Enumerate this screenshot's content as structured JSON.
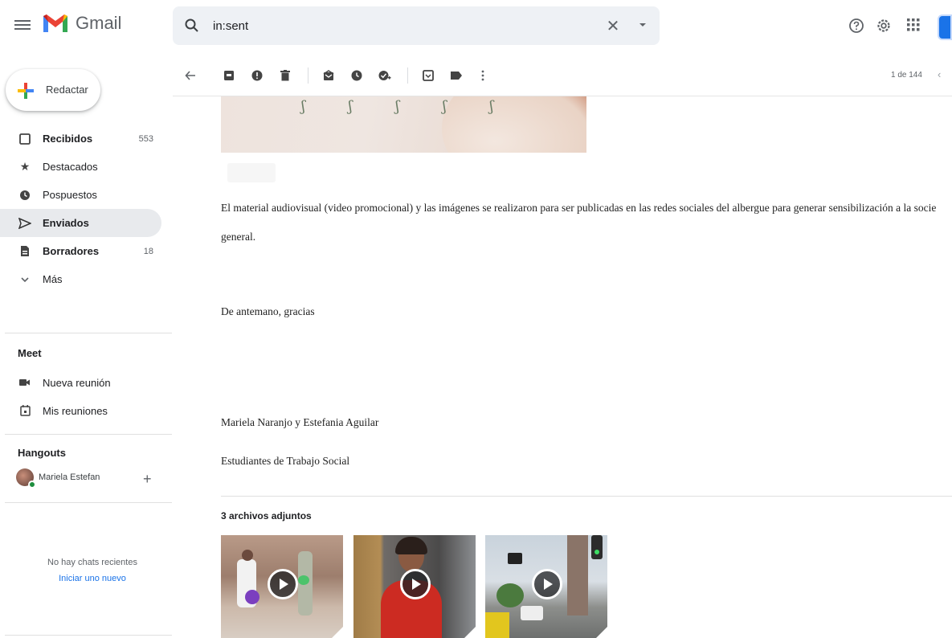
{
  "header": {
    "app_name": "Gmail",
    "search": {
      "value": "in:sent",
      "clear_label": "✕"
    }
  },
  "sidebar": {
    "compose_label": "Redactar",
    "items": [
      {
        "label": "Recibidos",
        "count": "553",
        "icon": "inbox-icon",
        "bold": true,
        "active": false
      },
      {
        "label": "Destacados",
        "count": "",
        "icon": "star-icon",
        "bold": false,
        "active": false
      },
      {
        "label": "Pospuestos",
        "count": "",
        "icon": "clock-icon",
        "bold": false,
        "active": false
      },
      {
        "label": "Enviados",
        "count": "",
        "icon": "send-icon",
        "bold": true,
        "active": true
      },
      {
        "label": "Borradores",
        "count": "18",
        "icon": "draft-icon",
        "bold": true,
        "active": false
      },
      {
        "label": "Más",
        "count": "",
        "icon": "chevron-down-icon",
        "bold": false,
        "active": false
      }
    ],
    "meet": {
      "title": "Meet",
      "new_meeting": "Nueva reunión",
      "my_meetings": "Mis reuniones"
    },
    "hangouts": {
      "title": "Hangouts",
      "user_name": "Mariela Estefan",
      "no_chats": "No hay chats recientes",
      "start_new": "Iniciar uno nuevo"
    }
  },
  "toolbar": {
    "pager": "1 de 144",
    "prev_glyph": "‹"
  },
  "message": {
    "paragraph_line1": "El material audiovisual (video promocional) y las imágenes se realizaron para ser publicadas en las redes sociales del albergue para generar sensibilización a la socie",
    "paragraph_line2": "general.",
    "thanks": "De antemano, gracias",
    "signature_names": "Mariela Naranjo y Estefania Aguilar",
    "signature_role": "Estudiantes de Trabajo Social",
    "attachments_title": "3 archivos adjuntos"
  },
  "colors": {
    "accent_blue": "#1a73e8",
    "active_nav_bg": "#e8eaed",
    "search_bg": "#eef1f5",
    "online_green": "#1e8e3e"
  }
}
